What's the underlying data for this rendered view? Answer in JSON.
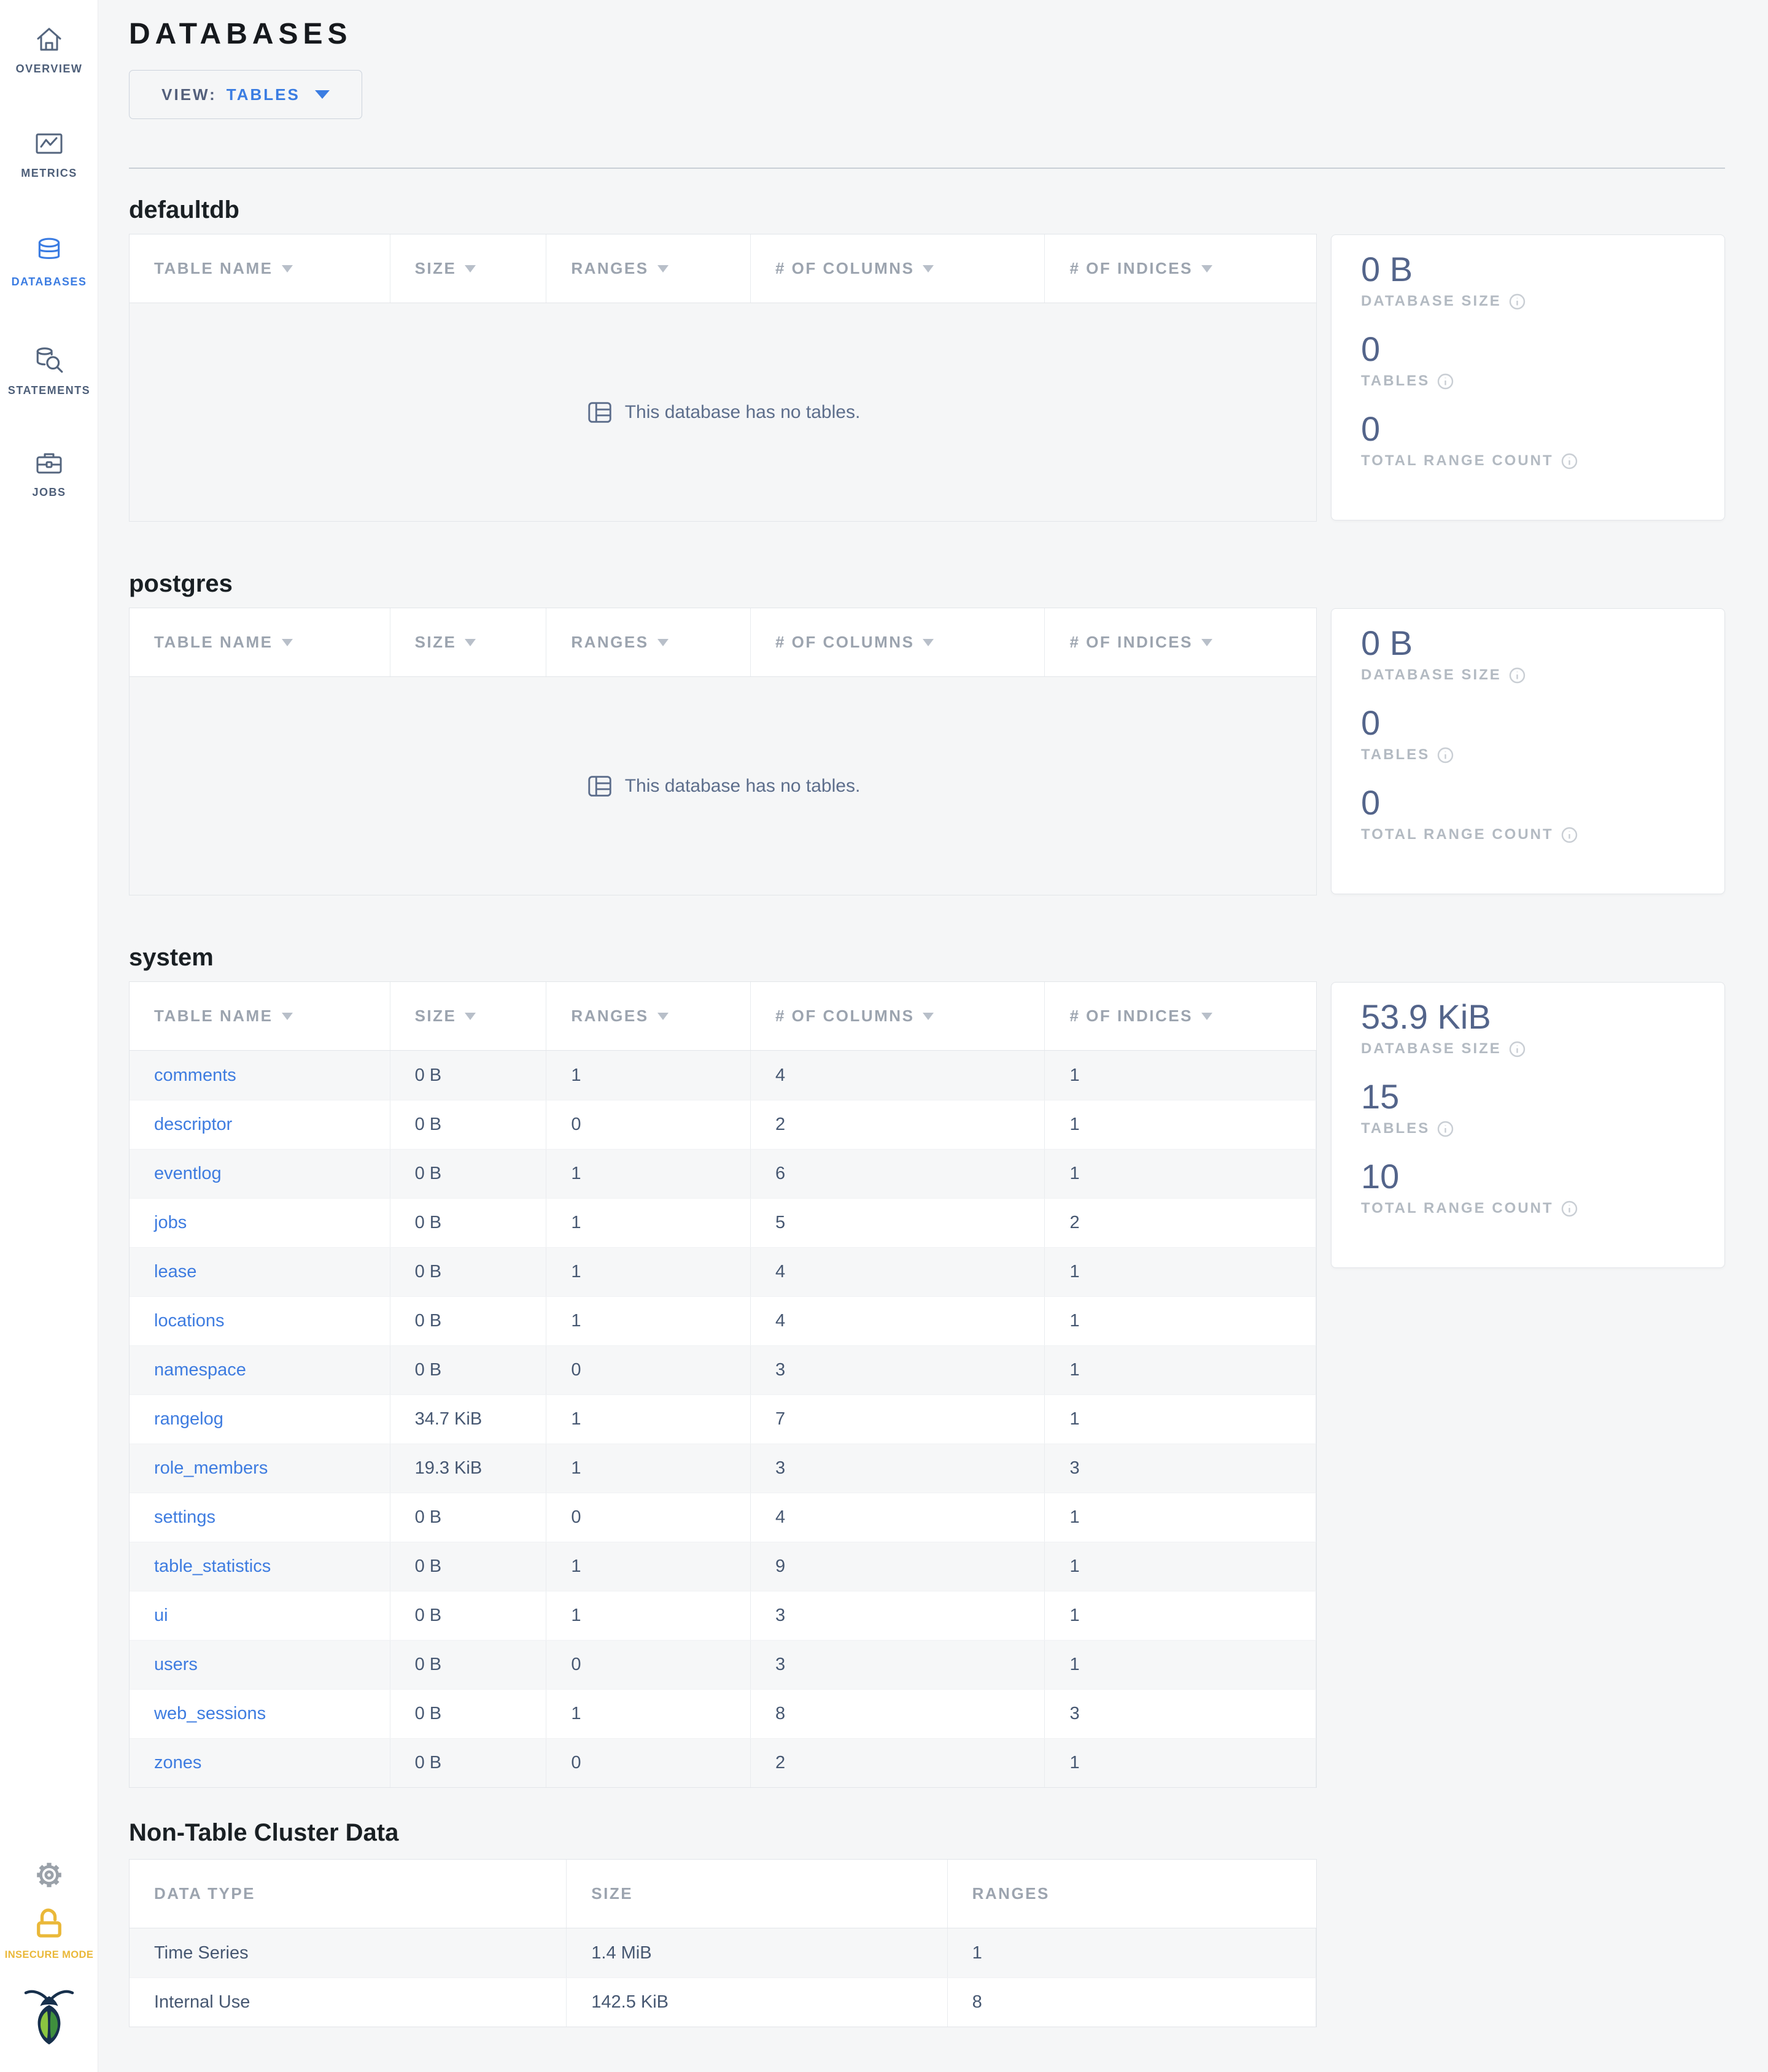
{
  "header": {
    "title": "DATABASES",
    "view_label": "VIEW:",
    "view_value": "TABLES"
  },
  "sidebar": {
    "items": [
      {
        "label": "OVERVIEW",
        "icon": "home-icon",
        "active": false
      },
      {
        "label": "METRICS",
        "icon": "metrics-icon",
        "active": false
      },
      {
        "label": "DATABASES",
        "icon": "databases-icon",
        "active": true
      },
      {
        "label": "STATEMENTS",
        "icon": "statements-icon",
        "active": false
      },
      {
        "label": "JOBS",
        "icon": "jobs-icon",
        "active": false
      }
    ],
    "insecure_mode_label": "INSECURE MODE"
  },
  "table_columns": [
    {
      "label": "TABLE NAME",
      "sortable": true
    },
    {
      "label": "SIZE",
      "sortable": true
    },
    {
      "label": "RANGES",
      "sortable": true
    },
    {
      "label": "# OF COLUMNS",
      "sortable": true
    },
    {
      "label": "# OF INDICES",
      "sortable": true
    }
  ],
  "empty_message": "This database has no tables.",
  "stats_labels": {
    "size": "DATABASE SIZE",
    "tables": "TABLES",
    "ranges": "TOTAL RANGE COUNT"
  },
  "sections": [
    {
      "name": "defaultdb",
      "empty": true,
      "stats": {
        "size": "0 B",
        "tables": "0",
        "ranges": "0"
      }
    },
    {
      "name": "postgres",
      "empty": true,
      "stats": {
        "size": "0 B",
        "tables": "0",
        "ranges": "0"
      }
    },
    {
      "name": "system",
      "empty": false,
      "rows": [
        {
          "name": "comments",
          "size": "0 B",
          "ranges": "1",
          "columns": "4",
          "indices": "1"
        },
        {
          "name": "descriptor",
          "size": "0 B",
          "ranges": "0",
          "columns": "2",
          "indices": "1"
        },
        {
          "name": "eventlog",
          "size": "0 B",
          "ranges": "1",
          "columns": "6",
          "indices": "1"
        },
        {
          "name": "jobs",
          "size": "0 B",
          "ranges": "1",
          "columns": "5",
          "indices": "2"
        },
        {
          "name": "lease",
          "size": "0 B",
          "ranges": "1",
          "columns": "4",
          "indices": "1"
        },
        {
          "name": "locations",
          "size": "0 B",
          "ranges": "1",
          "columns": "4",
          "indices": "1"
        },
        {
          "name": "namespace",
          "size": "0 B",
          "ranges": "0",
          "columns": "3",
          "indices": "1"
        },
        {
          "name": "rangelog",
          "size": "34.7 KiB",
          "ranges": "1",
          "columns": "7",
          "indices": "1"
        },
        {
          "name": "role_members",
          "size": "19.3 KiB",
          "ranges": "1",
          "columns": "3",
          "indices": "3"
        },
        {
          "name": "settings",
          "size": "0 B",
          "ranges": "0",
          "columns": "4",
          "indices": "1"
        },
        {
          "name": "table_statistics",
          "size": "0 B",
          "ranges": "1",
          "columns": "9",
          "indices": "1"
        },
        {
          "name": "ui",
          "size": "0 B",
          "ranges": "1",
          "columns": "3",
          "indices": "1"
        },
        {
          "name": "users",
          "size": "0 B",
          "ranges": "0",
          "columns": "3",
          "indices": "1"
        },
        {
          "name": "web_sessions",
          "size": "0 B",
          "ranges": "1",
          "columns": "8",
          "indices": "3"
        },
        {
          "name": "zones",
          "size": "0 B",
          "ranges": "0",
          "columns": "2",
          "indices": "1"
        }
      ],
      "stats": {
        "size": "53.9 KiB",
        "tables": "15",
        "ranges": "10"
      }
    }
  ],
  "non_table": {
    "title": "Non-Table Cluster Data",
    "columns": [
      {
        "label": "DATA TYPE"
      },
      {
        "label": "SIZE"
      },
      {
        "label": "RANGES"
      }
    ],
    "rows": [
      {
        "type": "Time Series",
        "size": "1.4 MiB",
        "ranges": "1"
      },
      {
        "type": "Internal Use",
        "size": "142.5 KiB",
        "ranges": "8"
      }
    ]
  },
  "colors": {
    "accent_blue": "#3b7de2",
    "insecure_yellow": "#eab839",
    "stat_slate": "#53648a"
  }
}
